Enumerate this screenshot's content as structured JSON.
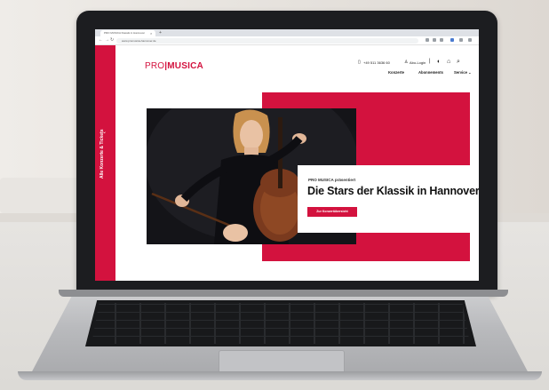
{
  "browser": {
    "tab_title": "PRO MUSICA Klassik in Hannover",
    "tab_close": "×",
    "new_tab": "+",
    "url": "www.promusica-hannover.de"
  },
  "site": {
    "brand": {
      "pro": "PRO",
      "musica": "MUSICA"
    },
    "phone": "+49 511 3636 60",
    "login": "Abo-Login",
    "nav": [
      "Konzerte",
      "Abonnements",
      "Service ⌄"
    ],
    "sidebar_label": "Alle Konzerte & Tickets",
    "hero": {
      "kicker": "PRO MUSICA präsentiert",
      "headline": "Die Stars der Klassik in Hannover",
      "cta": "Zur Konzertübersicht"
    }
  },
  "colors": {
    "brand_red": "#d3123e"
  }
}
